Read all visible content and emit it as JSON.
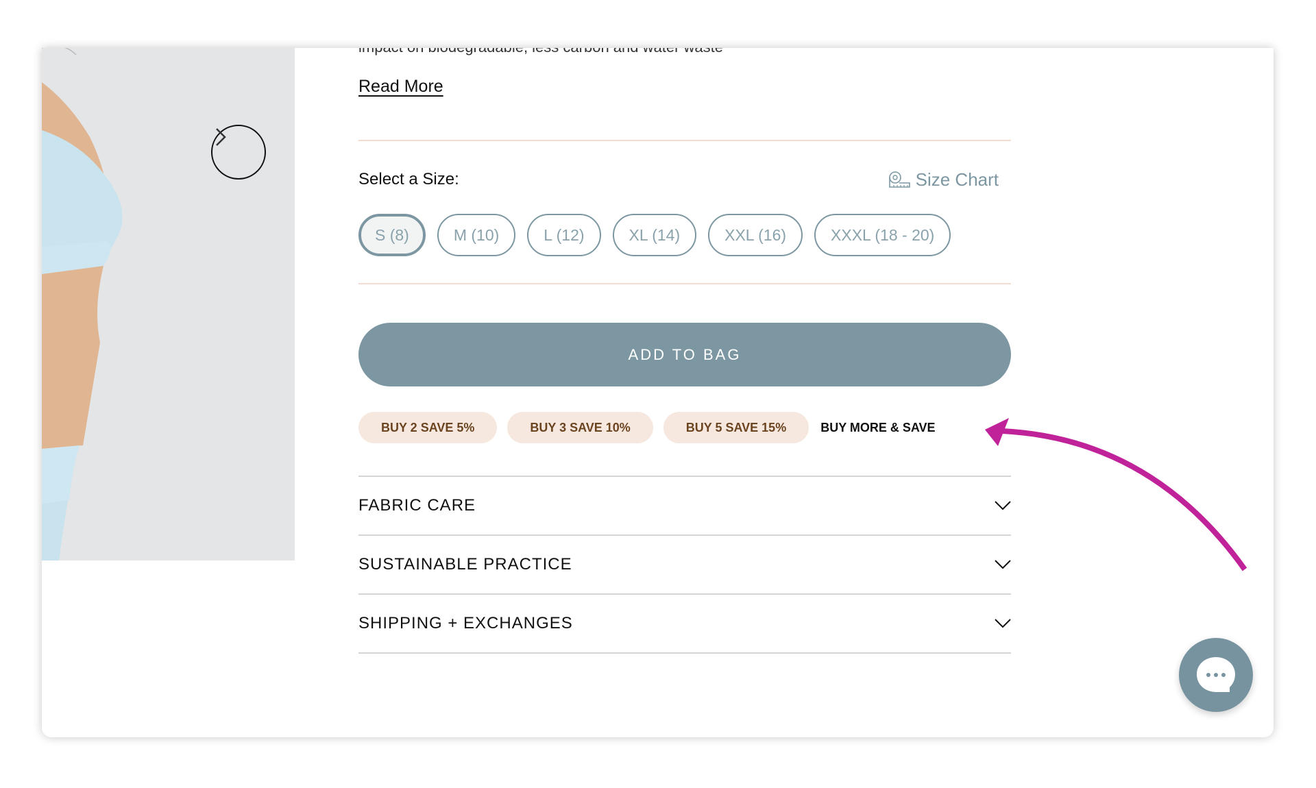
{
  "gallery": {
    "next_label": "Next image"
  },
  "description": {
    "clipped_line": "impact on biodegradable, less carbon and water waste",
    "read_more": "Read More"
  },
  "size_selector": {
    "label": "Select a Size:",
    "size_chart": "Size Chart",
    "selected": "S (8)",
    "options": [
      "S (8)",
      "M (10)",
      "L (12)",
      "XL (14)",
      "XXL (16)",
      "XXXL (18 - 20)"
    ]
  },
  "cart": {
    "add_to_bag": "ADD TO BAG"
  },
  "promotions": {
    "tiers": [
      "BUY 2 SAVE 5%",
      "BUY 3 SAVE 10%",
      "BUY 5 SAVE 15%"
    ],
    "label": "BUY MORE & SAVE"
  },
  "accordion": [
    {
      "label": "FABRIC CARE",
      "expanded": false
    },
    {
      "label": "SUSTAINABLE PRACTICE",
      "expanded": false
    },
    {
      "label": "SHIPPING + EXCHANGES",
      "expanded": false
    }
  ],
  "colors": {
    "accent": "#7c97a2",
    "promo_bg": "#f6e8df",
    "promo_text": "#6b4420",
    "annotation": "#c0229a",
    "divider": "#f3dcd2"
  },
  "icons": {
    "next": "chevron-right-icon",
    "size_chart": "measuring-tape-icon",
    "accordion": "chevron-down-icon",
    "chat": "chat-bubble-icon"
  }
}
